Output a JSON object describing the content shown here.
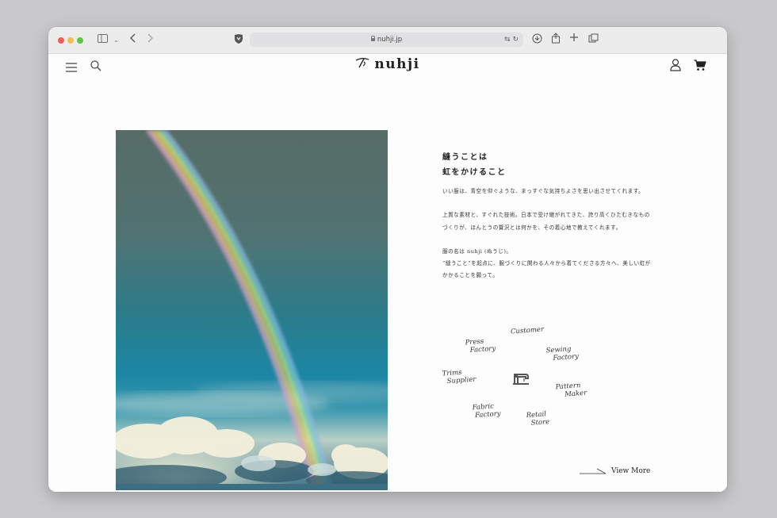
{
  "browser": {
    "url": "nuhji.jp",
    "colors": {
      "close": "#ee5e56",
      "minimize": "#f4bd4f",
      "zoom": "#5ec544"
    }
  },
  "site": {
    "brand": "nuhji",
    "heading_line1": "縫うことは",
    "heading_line2": "虹をかけること",
    "paragraph1": "いい服は、青空を仰ぐような、まっすぐな気持ちよさを思い出させてくれます。",
    "paragraph2": "上質な素材と、すぐれた技術。日本で受け継がれてきた、誇り高くひたむきなものづくりが、ほんとうの贅沢とは何かを、その着心地で教えてくれます。",
    "paragraph3_line1": "服の名は nuhji (ぬうじ)。",
    "paragraph3_line2": "“縫うこと”を起点に、服づくりに関わる人々から着てくださる方々へ、美しい虹がかかることを願って。",
    "diagram": {
      "customer": "Customer",
      "press_1": "Press",
      "press_2": "Factory",
      "sewing_1": "Sewing",
      "sewing_2": "Factory",
      "trims_1": "Trims",
      "trims_2": "Supplier",
      "pattern_1": "Pattern",
      "pattern_2": "Maker",
      "fabric_1": "Fabric",
      "fabric_2": "Factory",
      "retail_1": "Retail",
      "retail_2": "Store"
    },
    "view_more": "View More"
  }
}
